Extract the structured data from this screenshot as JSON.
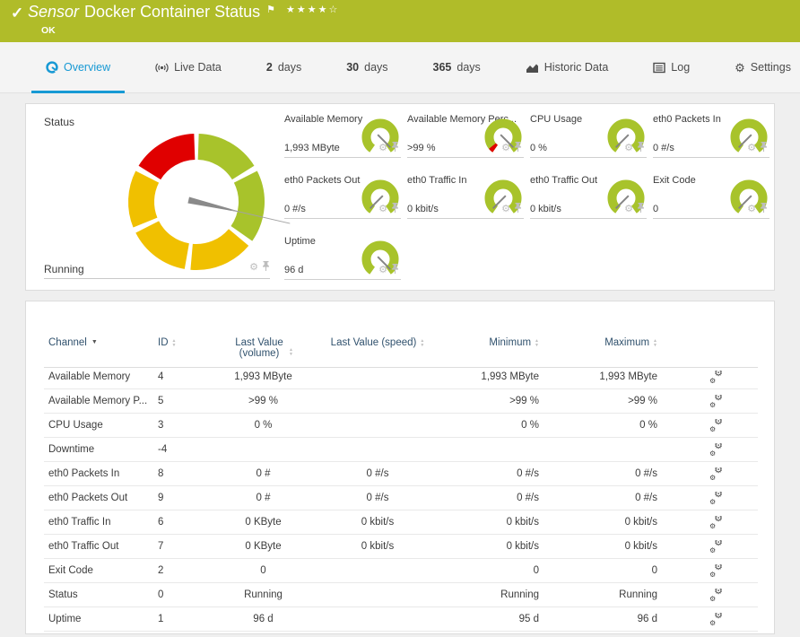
{
  "header": {
    "check_icon": "check",
    "kicker": "Sensor",
    "title": "Docker Container Status",
    "status": "OK",
    "rating_filled": 4,
    "rating_total": 5
  },
  "tabs": [
    {
      "label": "Overview",
      "icon": "gauge",
      "active": true
    },
    {
      "label": "Live Data",
      "icon": "broadcast"
    },
    {
      "prefix": "2",
      "label": "days"
    },
    {
      "prefix": "30",
      "label": "days"
    },
    {
      "prefix": "365",
      "label": "days"
    },
    {
      "label": "Historic Data",
      "icon": "area-chart"
    },
    {
      "label": "Log",
      "icon": "log"
    },
    {
      "label": "Settings",
      "icon": "gear"
    }
  ],
  "status_tile": {
    "title": "Status",
    "value": "Running"
  },
  "tiles": [
    {
      "title": "Available Memory",
      "value": "1,993 MByte",
      "needle": "max",
      "red_tick": false
    },
    {
      "title": "Available Memory Perc...",
      "value": ">99 %",
      "needle": "max",
      "red_tick": true
    },
    {
      "title": "CPU Usage",
      "value": "0 %",
      "needle": "min",
      "red_tick": false
    },
    {
      "title": "eth0 Packets In",
      "value": "0 #/s",
      "needle": "min",
      "red_tick": false
    },
    {
      "title": "eth0 Packets Out",
      "value": "0 #/s",
      "needle": "min",
      "red_tick": false
    },
    {
      "title": "eth0 Traffic In",
      "value": "0 kbit/s",
      "needle": "min",
      "red_tick": false
    },
    {
      "title": "eth0 Traffic Out",
      "value": "0 kbit/s",
      "needle": "min",
      "red_tick": false
    },
    {
      "title": "Exit Code",
      "value": "0",
      "needle": "min",
      "red_tick": false
    },
    {
      "title": "Uptime",
      "value": "96 d",
      "needle": "max",
      "red_tick": false
    }
  ],
  "table": {
    "columns": [
      "Channel",
      "ID",
      "Last Value (volume)",
      "Last Value (speed)",
      "Minimum",
      "Maximum"
    ],
    "sorted_by": "Channel",
    "rows": [
      [
        "Available Memory",
        "4",
        "1,993 MByte",
        "",
        "1,993 MByte",
        "1,993 MByte"
      ],
      [
        "Available Memory P...",
        "5",
        ">99 %",
        "",
        ">99 %",
        ">99 %"
      ],
      [
        "CPU Usage",
        "3",
        "0 %",
        "",
        "0 %",
        "0 %"
      ],
      [
        "Downtime",
        "-4",
        "",
        "",
        "",
        ""
      ],
      [
        "eth0 Packets In",
        "8",
        "0 #",
        "0 #/s",
        "0 #/s",
        "0 #/s"
      ],
      [
        "eth0 Packets Out",
        "9",
        "0 #",
        "0 #/s",
        "0 #/s",
        "0 #/s"
      ],
      [
        "eth0 Traffic In",
        "6",
        "0 KByte",
        "0 kbit/s",
        "0 kbit/s",
        "0 kbit/s"
      ],
      [
        "eth0 Traffic Out",
        "7",
        "0 KByte",
        "0 kbit/s",
        "0 kbit/s",
        "0 kbit/s"
      ],
      [
        "Exit Code",
        "2",
        "0",
        "",
        "0",
        "0"
      ],
      [
        "Status",
        "0",
        "Running",
        "",
        "Running",
        "Running"
      ],
      [
        "Uptime",
        "1",
        "96 d",
        "",
        "95 d",
        "96 d"
      ]
    ]
  },
  "colors": {
    "ok_green": "#b0bc29",
    "gauge_green": "#a8c32b",
    "gauge_yellow": "#f0c000",
    "gauge_red": "#e00000",
    "accent_blue": "#1799d4",
    "needle_gray": "#8a8a8a"
  }
}
